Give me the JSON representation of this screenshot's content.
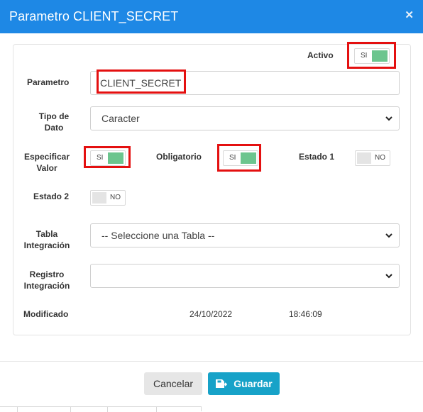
{
  "dialog": {
    "title": "Parametro CLIENT_SECRET",
    "close_icon": "close-icon"
  },
  "form": {
    "activo": {
      "label": "Activo",
      "state": "SI",
      "on": true
    },
    "parametro": {
      "label": "Parametro",
      "value": "CLIENT_SECRET"
    },
    "tipo_dato": {
      "label_line1": "Tipo de",
      "label_line2": "Dato",
      "selected": "Caracter"
    },
    "especificar_valor": {
      "label_line1": "Especificar",
      "label_line2": "Valor",
      "state": "SI",
      "on": true
    },
    "obligatorio": {
      "label": "Obligatorio",
      "state": "SI",
      "on": true
    },
    "estado1": {
      "label": "Estado 1",
      "state": "NO",
      "on": false
    },
    "estado2": {
      "label": "Estado 2",
      "state": "NO",
      "on": false
    },
    "tabla_integracion": {
      "label_line1": "Tabla",
      "label_line2": "Integración",
      "selected": "-- Seleccione una Tabla --"
    },
    "registro_integracion": {
      "label_line1": "Registro",
      "label_line2": "Integración",
      "selected": ""
    },
    "modificado": {
      "label": "Modificado",
      "date": "24/10/2022",
      "time": "18:46:09"
    }
  },
  "footer": {
    "cancel_label": "Cancelar",
    "save_label": "Guardar",
    "save_icon": "save-icon"
  },
  "colors": {
    "header": "#1e88e5",
    "toggle_on": "#6cc58e",
    "toggle_off": "#e4e4e4",
    "highlight": "#e41010",
    "save_button": "#17a2c8"
  }
}
